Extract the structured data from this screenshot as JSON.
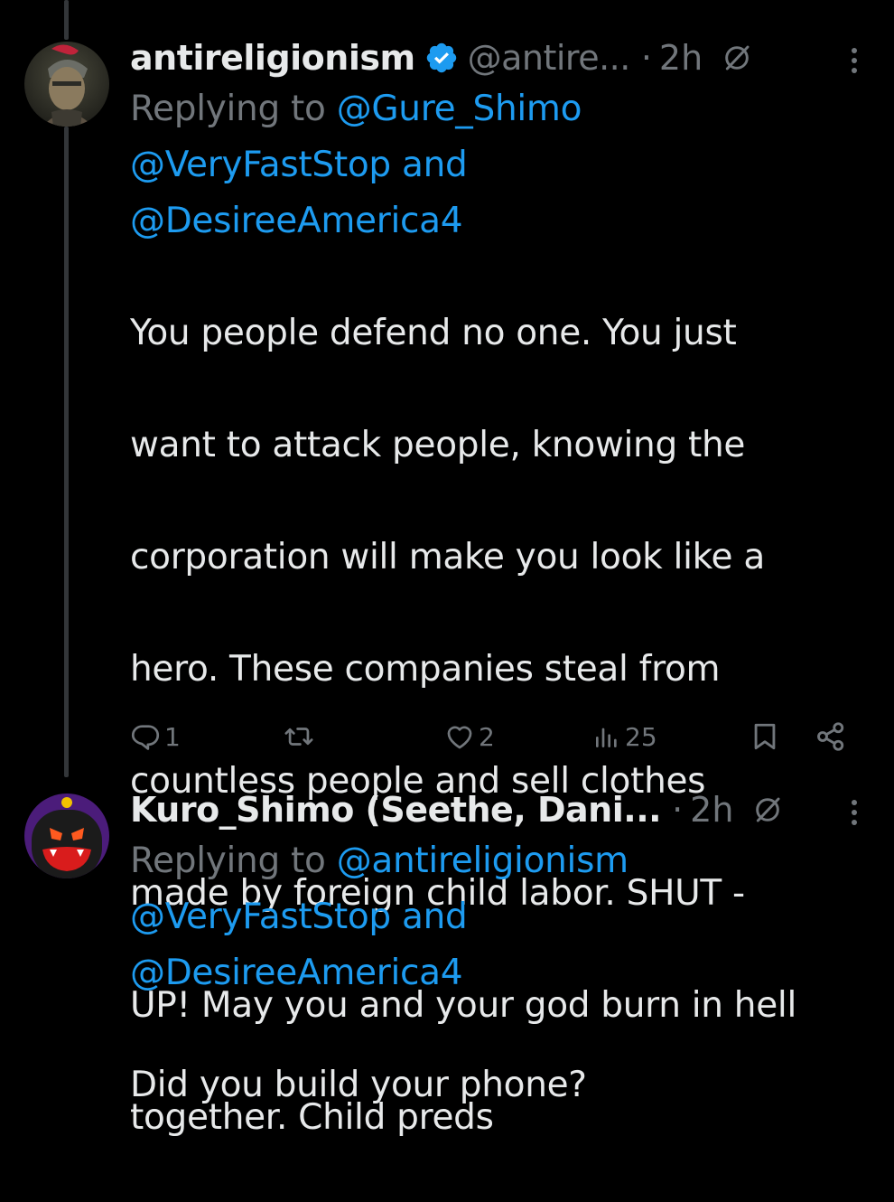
{
  "tweets": [
    {
      "display_name": "antireligionism",
      "handle": "@antire...",
      "separator": "·",
      "time": "2h",
      "replying_prefix": "Replying to",
      "mentions": [
        "@Gure_Shimo",
        "@VeryFastStop",
        "@DesireeAmerica4"
      ],
      "mention_joiner": "and",
      "body_lines": [
        "You people defend no one. You just",
        "want to attack people, knowing the",
        "corporation will make you look like a",
        "hero. These companies steal from",
        "countless people and sell clothes",
        "made by foreign child labor. SHUT -",
        "UP! May you and your god burn in hell",
        "together. Child preds"
      ],
      "actions": {
        "replies": "1",
        "reposts": "",
        "likes": "2",
        "views": "25"
      }
    },
    {
      "display_name": "Kuro_Shimo (Seethe, Dani...",
      "separator": "·",
      "time": "2h",
      "replying_prefix": "Replying to",
      "mentions": [
        "@antireligionism",
        "@VeryFastStop",
        "@DesireeAmerica4"
      ],
      "mention_joiner": "and",
      "body_lines": [
        "Did you build your phone?"
      ]
    }
  ],
  "colors": {
    "background": "#000000",
    "text": "#e7e9ea",
    "secondary": "#71767b",
    "link": "#1d9bf0",
    "verified": "#1d9bf0",
    "thread_line": "#333639"
  },
  "icons": {
    "verified": "verified-badge-icon",
    "grok": "grok-icon",
    "more": "more-vertical-icon",
    "reply": "reply-icon",
    "repost": "repost-icon",
    "like": "heart-icon",
    "views": "views-chart-icon",
    "bookmark": "bookmark-icon",
    "share": "share-icon"
  }
}
